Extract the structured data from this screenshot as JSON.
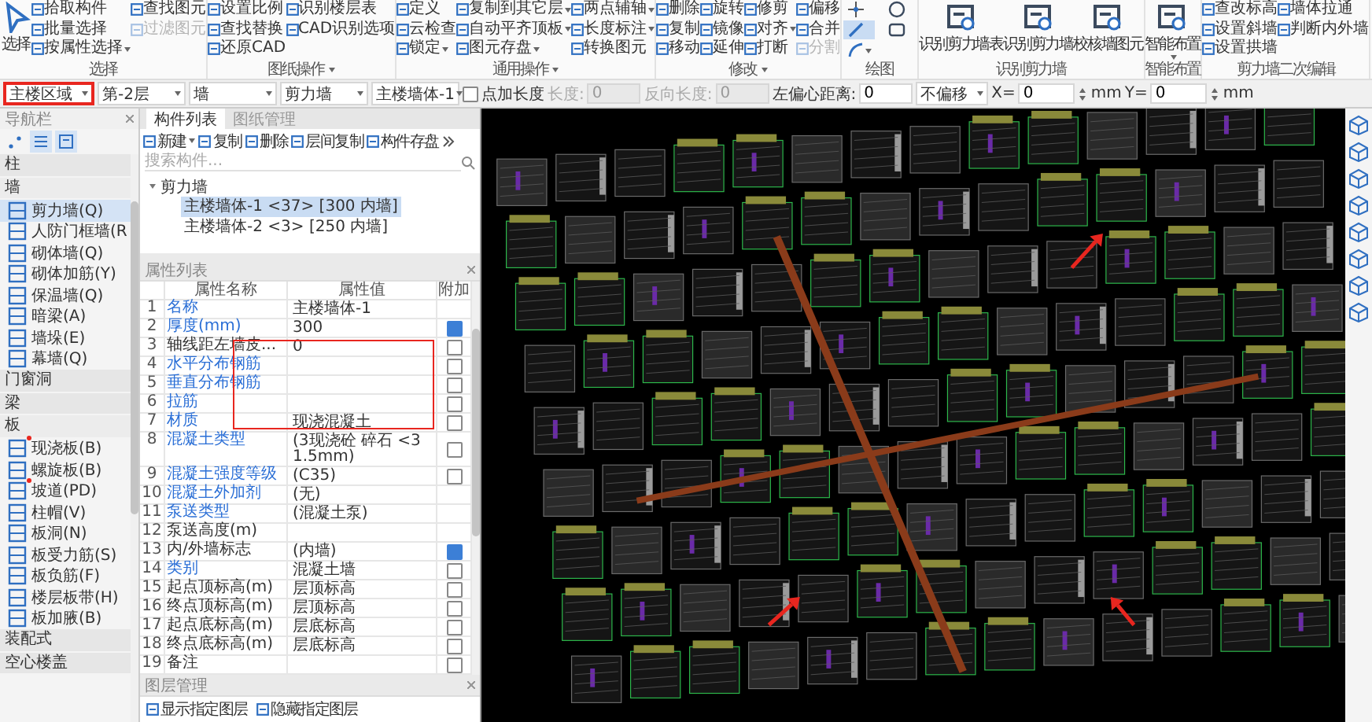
{
  "ribbon": {
    "groups": [
      {
        "label": "选择",
        "dropdown": false,
        "columns": [
          {
            "kind": "pointer",
            "label": "选择"
          },
          {
            "kind": "stack",
            "items": [
              {
                "label": "拾取构件",
                "disabled": false,
                "dropdown": false
              },
              {
                "label": "批量选择",
                "disabled": false,
                "dropdown": false
              },
              {
                "label": "按属性选择",
                "disabled": false,
                "dropdown": true
              }
            ]
          },
          {
            "kind": "stack",
            "items": [
              {
                "label": "查找图元",
                "disabled": false,
                "dropdown": false
              },
              {
                "label": "过滤图元",
                "disabled": true,
                "dropdown": false
              }
            ]
          }
        ]
      },
      {
        "label": "图纸操作",
        "dropdown": true,
        "columns": [
          {
            "kind": "stack",
            "items": [
              {
                "label": "设置比例",
                "disabled": false,
                "dropdown": false
              },
              {
                "label": "查找替换",
                "disabled": false,
                "dropdown": false
              },
              {
                "label": "还原CAD",
                "disabled": false,
                "dropdown": false
              }
            ]
          },
          {
            "kind": "stack",
            "items": [
              {
                "label": "识别楼层表",
                "disabled": false,
                "dropdown": false
              },
              {
                "label": "CAD识别选项",
                "disabled": false,
                "dropdown": false
              }
            ]
          }
        ]
      },
      {
        "label": "通用操作",
        "dropdown": true,
        "columns": [
          {
            "kind": "stack",
            "items": [
              {
                "label": "定义",
                "disabled": false,
                "dropdown": false
              },
              {
                "label": "云检查",
                "disabled": false,
                "dropdown": false
              },
              {
                "label": "锁定",
                "disabled": false,
                "dropdown": true
              }
            ]
          },
          {
            "kind": "stack",
            "items": [
              {
                "label": "复制到其它层",
                "disabled": false,
                "dropdown": true
              },
              {
                "label": "自动平齐顶板",
                "disabled": false,
                "dropdown": true
              },
              {
                "label": "图元存盘",
                "disabled": false,
                "dropdown": true
              }
            ]
          },
          {
            "kind": "stack",
            "items": [
              {
                "label": "两点辅轴",
                "disabled": false,
                "dropdown": true
              },
              {
                "label": "长度标注",
                "disabled": false,
                "dropdown": true
              },
              {
                "label": "转换图元",
                "disabled": false,
                "dropdown": false
              }
            ]
          }
        ]
      },
      {
        "label": "修改",
        "dropdown": true,
        "columns": [
          {
            "kind": "stack",
            "items": [
              {
                "label": "删除",
                "disabled": false,
                "dropdown": false
              },
              {
                "label": "复制",
                "disabled": false,
                "dropdown": false
              },
              {
                "label": "移动",
                "disabled": false,
                "dropdown": false
              }
            ]
          },
          {
            "kind": "stack",
            "items": [
              {
                "label": "旋转",
                "disabled": false,
                "dropdown": false
              },
              {
                "label": "镜像",
                "disabled": false,
                "dropdown": false
              },
              {
                "label": "延伸",
                "disabled": false,
                "dropdown": false
              }
            ]
          },
          {
            "kind": "stack",
            "items": [
              {
                "label": "修剪",
                "disabled": false,
                "dropdown": false
              },
              {
                "label": "对齐",
                "disabled": false,
                "dropdown": true
              },
              {
                "label": "打断",
                "disabled": false,
                "dropdown": false
              }
            ]
          },
          {
            "kind": "stack",
            "items": [
              {
                "label": "偏移",
                "disabled": false,
                "dropdown": false
              },
              {
                "label": "合并",
                "disabled": false,
                "dropdown": false
              },
              {
                "label": "分割",
                "disabled": true,
                "dropdown": false
              }
            ]
          }
        ]
      },
      {
        "label": "绘图",
        "dropdown": false,
        "columns": [
          {
            "kind": "tools",
            "items": [
              {
                "kind": "point",
                "selected": false,
                "dropdown": false
              },
              {
                "kind": "line",
                "selected": true,
                "dropdown": false
              },
              {
                "kind": "arc",
                "selected": false,
                "dropdown": true
              }
            ]
          },
          {
            "kind": "tools",
            "items": [
              {
                "kind": "circle",
                "selected": false,
                "dropdown": false
              },
              {
                "kind": "rect",
                "selected": false,
                "dropdown": false
              }
            ]
          }
        ]
      },
      {
        "label": "识别剪力墙",
        "dropdown": false,
        "columns": [
          {
            "kind": "large",
            "label": "识别剪力墙表",
            "dropdown": false
          },
          {
            "kind": "large",
            "label": "识别剪力墙",
            "dropdown": false
          },
          {
            "kind": "large",
            "label": "校核墙图元",
            "dropdown": false
          }
        ]
      },
      {
        "label": "智能布置",
        "dropdown": false,
        "columns": [
          {
            "kind": "large",
            "label": "智能布置",
            "dropdown": true
          }
        ]
      },
      {
        "label": "剪力墙二次编辑",
        "dropdown": false,
        "columns": [
          {
            "kind": "stack",
            "items": [
              {
                "label": "查改标高",
                "disabled": false,
                "dropdown": false
              },
              {
                "label": "设置斜墙",
                "disabled": false,
                "dropdown": false
              },
              {
                "label": "设置拱墙",
                "disabled": false,
                "dropdown": false
              }
            ]
          },
          {
            "kind": "stack",
            "items": [
              {
                "label": "墙体拉通",
                "disabled": false,
                "dropdown": false
              },
              {
                "label": "判断内外墙",
                "disabled": false,
                "dropdown": false
              }
            ]
          }
        ]
      }
    ]
  },
  "toolbar": [
    {
      "kind": "dropdown",
      "value": "主楼区域",
      "highlighted": true
    },
    {
      "kind": "dropdown",
      "value": "第-2层",
      "highlighted": false
    },
    {
      "kind": "dropdown",
      "value": "墙",
      "highlighted": false
    },
    {
      "kind": "dropdown",
      "value": "剪力墙",
      "highlighted": false
    },
    {
      "kind": "dropdown",
      "value": "主楼墙体-1",
      "highlighted": false
    },
    {
      "kind": "checkbox",
      "label": "点加长度",
      "checked": false
    },
    {
      "kind": "field",
      "label": "长度:",
      "value": "0",
      "disabled": true
    },
    {
      "kind": "field",
      "label": "反向长度:",
      "value": "0",
      "disabled": true
    },
    {
      "kind": "field",
      "label": "左偏心距离:",
      "value": "0",
      "disabled": false
    },
    {
      "kind": "dropdown",
      "value": "不偏移",
      "highlighted": false
    },
    {
      "kind": "spinner",
      "label": "X=",
      "value": "0",
      "unit": "mm"
    },
    {
      "kind": "spinner",
      "label": "Y=",
      "value": "0",
      "unit": "mm"
    }
  ],
  "navigation": {
    "title": "导航栏",
    "view_modes": [
      {
        "kind": "dots",
        "selected": false
      },
      {
        "kind": "list",
        "selected": true
      },
      {
        "kind": "panel",
        "selected": true
      }
    ],
    "categories": [
      {
        "label": "柱"
      },
      {
        "label": "墙",
        "expanded": true,
        "children": [
          {
            "label": "剪力墙(Q)",
            "selected": true,
            "flagged": false
          },
          {
            "label": "人防门框墙(R",
            "selected": false,
            "flagged": false
          },
          {
            "label": "砌体墙(Q)",
            "selected": false,
            "flagged": false
          },
          {
            "label": "砌体加筋(Y)",
            "selected": false,
            "flagged": false
          },
          {
            "label": "保温墙(Q)",
            "selected": false,
            "flagged": false
          },
          {
            "label": "暗梁(A)",
            "selected": false,
            "flagged": false
          },
          {
            "label": "墙垛(E)",
            "selected": false,
            "flagged": false
          },
          {
            "label": "幕墙(Q)",
            "selected": false,
            "flagged": false
          }
        ]
      },
      {
        "label": "门窗洞"
      },
      {
        "label": "梁"
      },
      {
        "label": "板",
        "expanded": true,
        "children": [
          {
            "label": "现浇板(B)",
            "selected": false,
            "flagged": true
          },
          {
            "label": "螺旋板(B)",
            "selected": false,
            "flagged": false
          },
          {
            "label": "坡道(PD)",
            "selected": false,
            "flagged": true
          },
          {
            "label": "柱帽(V)",
            "selected": false,
            "flagged": false
          },
          {
            "label": "板洞(N)",
            "selected": false,
            "flagged": false
          },
          {
            "label": "板受力筋(S)",
            "selected": false,
            "flagged": false
          },
          {
            "label": "板负筋(F)",
            "selected": false,
            "flagged": false
          },
          {
            "label": "楼层板带(H)",
            "selected": false,
            "flagged": false
          },
          {
            "label": "板加腋(B)",
            "selected": false,
            "flagged": false
          }
        ]
      },
      {
        "label": "装配式"
      },
      {
        "label": "空心楼盖"
      }
    ]
  },
  "components": {
    "tabs": [
      {
        "label": "构件列表",
        "selected": true
      },
      {
        "label": "图纸管理",
        "selected": false
      }
    ],
    "actions": [
      {
        "label": "新建",
        "dropdown": true
      },
      {
        "label": "复制",
        "dropdown": false
      },
      {
        "label": "删除",
        "dropdown": false
      },
      {
        "label": "层间复制",
        "dropdown": false
      },
      {
        "label": "构件存盘",
        "dropdown": false
      }
    ],
    "search": {
      "placeholder": "搜索构件..."
    },
    "tree": [
      {
        "label": "剪力墙",
        "expanded": true,
        "children": [
          {
            "label": "主楼墙体-1 <37> [300 内墙]",
            "selected": true
          },
          {
            "label": "主楼墙体-2 <3> [250 内墙]",
            "selected": false
          }
        ]
      }
    ]
  },
  "properties": {
    "title": "属性列表",
    "columns": [
      "属性名称",
      "属性值",
      "附加"
    ],
    "rows": [
      {
        "index": "1",
        "name": "名称",
        "value": "主楼墙体-1",
        "emphasized": true,
        "annotated": false
      },
      {
        "index": "2",
        "name": "厚度(mm)",
        "value": "300",
        "emphasized": true,
        "annotated": false,
        "checked": true
      },
      {
        "index": "3",
        "name": "轴线距左墙皮...",
        "value": "0",
        "emphasized": false,
        "annotated": true,
        "checked": false
      },
      {
        "index": "4",
        "name": "水平分布钢筋",
        "value": "",
        "emphasized": true,
        "annotated": true,
        "checked": false
      },
      {
        "index": "5",
        "name": "垂直分布钢筋",
        "value": "",
        "emphasized": true,
        "annotated": true,
        "checked": false
      },
      {
        "index": "6",
        "name": "拉筋",
        "value": "",
        "emphasized": true,
        "annotated": true,
        "checked": false
      },
      {
        "index": "7",
        "name": "材质",
        "value": "现浇混凝土",
        "emphasized": true,
        "annotated": true,
        "checked": false
      },
      {
        "index": "8",
        "name": "混凝土类型",
        "value": "(3现浇砼 碎石 <31.5mm)",
        "emphasized": true,
        "annotated": false,
        "checked": false
      },
      {
        "index": "9",
        "name": "混凝土强度等级",
        "value": "(C35)",
        "emphasized": true,
        "annotated": false,
        "checked": false
      },
      {
        "index": "10",
        "name": "混凝土外加剂",
        "value": "(无)",
        "emphasized": true,
        "annotated": false
      },
      {
        "index": "11",
        "name": "泵送类型",
        "value": "(混凝土泵)",
        "emphasized": true,
        "annotated": false
      },
      {
        "index": "12",
        "name": "泵送高度(m)",
        "value": "",
        "emphasized": false,
        "annotated": false
      },
      {
        "index": "13",
        "name": "内/外墙标志",
        "value": "(内墙)",
        "emphasized": false,
        "annotated": false,
        "checked": true
      },
      {
        "index": "14",
        "name": "类别",
        "value": "混凝土墙",
        "emphasized": true,
        "annotated": false,
        "checked": false
      },
      {
        "index": "15",
        "name": "起点顶标高(m)",
        "value": "层顶标高",
        "emphasized": false,
        "annotated": false,
        "checked": false
      },
      {
        "index": "16",
        "name": "终点顶标高(m)",
        "value": "层顶标高",
        "emphasized": false,
        "annotated": false,
        "checked": false
      },
      {
        "index": "17",
        "name": "起点底标高(m)",
        "value": "层底标高",
        "emphasized": false,
        "annotated": false,
        "checked": false
      },
      {
        "index": "18",
        "name": "终点底标高(m)",
        "value": "层底标高",
        "emphasized": false,
        "annotated": false,
        "checked": false
      },
      {
        "index": "19",
        "name": "备注",
        "value": "",
        "emphasized": false,
        "annotated": false,
        "checked": false
      }
    ]
  },
  "layers": {
    "title": "图层管理",
    "actions": [
      "显示指定图层",
      "隐藏指定图层"
    ]
  }
}
